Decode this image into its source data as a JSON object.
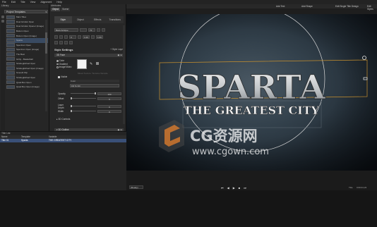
{
  "menu": [
    "File",
    "Edit",
    "Title",
    "View",
    "Alignment",
    "Help"
  ],
  "library": {
    "panel_title": "Library",
    "category": "Project Templates",
    "items": [
      "Main Titles",
      "Duel Grinder Open",
      "Duel Grinder Opener (Image)",
      "Bottom Open",
      "Bottom Open (Image)",
      "Sparta",
      "Spectrum Open",
      "Spectrum Open (Image)",
      "The Best",
      "Gritty - Basketball",
      "Strobeglitched Open",
      "Strobeglitched Open (Image)",
      "Smooth Flip",
      "Strobeglitched Open",
      "Quad Box Open",
      "Quad Box Open (Image)"
    ],
    "selected_index": 5
  },
  "attributes": {
    "panel_title": "Attributes",
    "tabs": [
      "Object",
      "Scene"
    ],
    "active_tab": 0,
    "sub_tabs": [
      "Style",
      "Object",
      "Effects",
      "Transitions"
    ],
    "active_sub_tab": 0,
    "font_name": "Bank Antique",
    "font_size": "72",
    "leading_value": "0",
    "tracking_value": "1.00",
    "kerning_value": "1.00",
    "style_settings_label": "Style Settings",
    "style_layer_label": "+ Style Layer",
    "face_label": "3D Face",
    "fill_options": [
      "Color",
      "Gradient",
      "Image/Video"
    ],
    "fill_selected": 0,
    "faint_label": "Mixed Texture: Textures Sample",
    "visible_label": "Visible",
    "fill_label": "Color",
    "blend_select": "Fill To Fill",
    "opacity_label": "Opacity",
    "opacity_value": "100",
    "offset_label": "Offset",
    "offset_value": "0",
    "layer_depth_label": "Layer Depth",
    "layer_depth_value": "0",
    "width_label": "Width",
    "width_value": "0",
    "controls_label": "3D Controls",
    "outline_label": "3D Outline"
  },
  "monitor": {
    "toolbar_items": [
      "Add Text",
      "Add Shape",
      "Edit Single Title Design",
      "Edit Styles"
    ],
    "title_main": "SPARTA",
    "title_sub": "THE GREATEST CITY",
    "zoom": "(Ready)",
    "title_label": "Title",
    "timecode": "0:00:01;23",
    "transport": [
      "⏮",
      "◀",
      "▶",
      "■",
      "⏭"
    ],
    "watermark_brand": "CG资源网",
    "watermark_url": "www.cgown.com"
  },
  "title_list": {
    "panel_title": "Title List",
    "columns": [
      "Name",
      "Template",
      "Variable"
    ],
    "row": [
      "Title 01",
      "Sparta",
      "THE GREATEST CITY"
    ]
  }
}
